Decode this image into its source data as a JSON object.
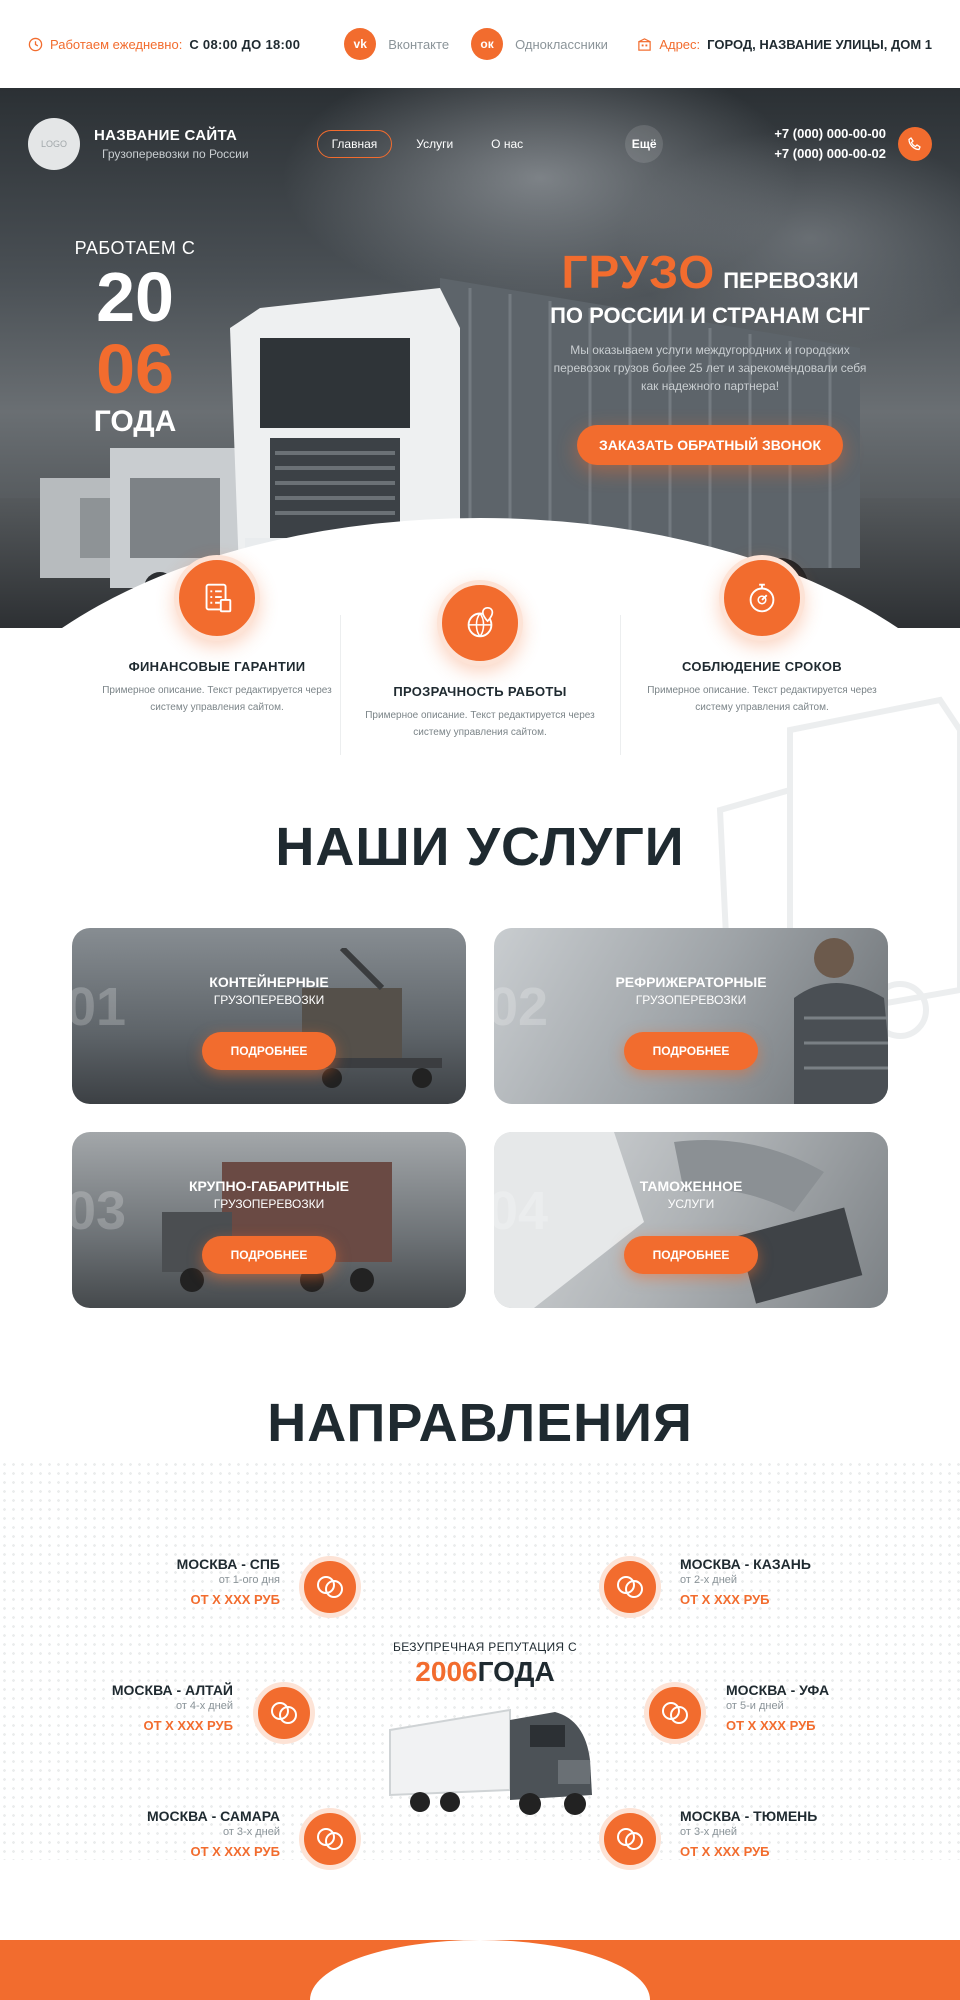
{
  "topbar": {
    "hours_label": "Работаем ежедневно:",
    "hours_value": "С 08:00 ДО 18:00",
    "vk_label": "Вконтакте",
    "ok_label": "Одноклассники",
    "address_label": "Адрес:",
    "address_value": "ГОРОД, НАЗВАНИЕ УЛИЦЫ, ДОМ 1"
  },
  "header": {
    "logo": "LOGO",
    "site_name": "НАЗВАНИЕ САЙТА",
    "site_tagline": "Грузоперевозки по России",
    "nav": [
      {
        "label": "Главная",
        "active": true
      },
      {
        "label": "Услуги",
        "active": false
      },
      {
        "label": "О нас",
        "active": false
      }
    ],
    "more": "Ещё",
    "phones": [
      "+7 (000) 000-00-00",
      "+7 (000) 000-00-02"
    ]
  },
  "hero": {
    "since_label": "РАБОТАЕМ С",
    "since_year_1": "20",
    "since_year_2": "06",
    "since_suffix": "ГОДА",
    "title_accent": "ГРУЗО",
    "title_rest": "ПЕРЕВОЗКИ",
    "title_line2": "ПО РОССИИ И СТРАНАМ СНГ",
    "description": "Мы оказываем услуги междугородних и городских перевозок грузов более 25 лет и зарекомендовали себя как надежного партнера!",
    "cta": "ЗАКАЗАТЬ ОБРАТНЫЙ ЗВОНОК"
  },
  "features": [
    {
      "title": "ФИНАНСОВЫЕ ГАРАНТИИ",
      "desc": "Примерное описание. Текст редактируется через систему управления сайтом.",
      "icon": "checklist-icon"
    },
    {
      "title": "ПРОЗРАЧНОСТЬ РАБОТЫ",
      "desc": "Примерное описание. Текст редактируется через систему управления сайтом.",
      "icon": "globe-pin-icon"
    },
    {
      "title": "СОБЛЮДЕНИЕ СРОКОВ",
      "desc": "Примерное описание. Текст редактируется через систему управления сайтом.",
      "icon": "stopwatch-icon"
    }
  ],
  "services": {
    "title": "НАШИ УСЛУГИ",
    "items": [
      {
        "num": "01",
        "title": "КОНТЕЙНЕРНЫЕ",
        "sub": "ГРУЗОПЕРЕВОЗКИ",
        "button": "ПОДРОБНЕЕ"
      },
      {
        "num": "02",
        "title": "РЕФРИЖЕРАТОРНЫЕ",
        "sub": "ГРУЗОПЕРЕВОЗКИ",
        "button": "ПОДРОБНЕЕ"
      },
      {
        "num": "03",
        "title": "КРУПНО-ГАБАРИТНЫЕ",
        "sub": "ГРУЗОПЕРЕВОЗКИ",
        "button": "ПОДРОБНЕЕ"
      },
      {
        "num": "04",
        "title": "ТАМОЖЕННОЕ",
        "sub": "УСЛУГИ",
        "button": "ПОДРОБНЕЕ"
      }
    ]
  },
  "directions": {
    "title": "НАПРАВЛЕНИЯ",
    "routes": [
      {
        "name": "МОСКВА - СПБ",
        "days": "от 1-ого дня",
        "price": "ОТ Х ХХХ РУБ"
      },
      {
        "name": "МОСКВА - КАЗАНЬ",
        "days": "от 2-х дней",
        "price": "ОТ Х ХХХ РУБ"
      },
      {
        "name": "МОСКВА - АЛТАЙ",
        "days": "от 4-х дней",
        "price": "ОТ Х ХХХ РУБ"
      },
      {
        "name": "МОСКВА - УФА",
        "days": "от 5-и дней",
        "price": "ОТ Х ХХХ РУБ"
      },
      {
        "name": "МОСКВА - САМАРА",
        "days": "от 3-х дней",
        "price": "ОТ Х ХХХ РУБ"
      },
      {
        "name": "МОСКВА - ТЮМЕНЬ",
        "days": "от 3-х дней",
        "price": "ОТ Х ХХХ РУБ"
      }
    ],
    "reputation_line1": "БЕЗУПРЕЧНАЯ РЕПУТАЦИЯ С",
    "reputation_year": "2006",
    "reputation_suffix": "ГОДА"
  },
  "colors": {
    "accent": "#f26c2e",
    "dark": "#1f2a30"
  }
}
